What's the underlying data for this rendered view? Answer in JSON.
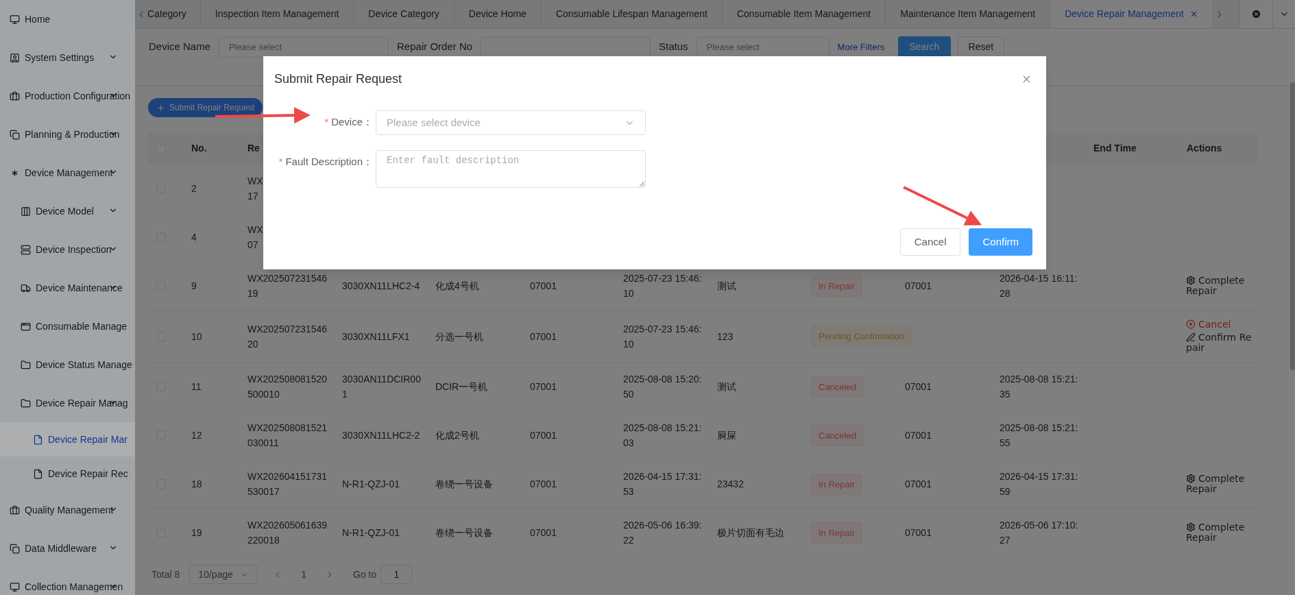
{
  "sidebar": {
    "items": [
      {
        "label": "Home",
        "has_submenu": false,
        "selected": false
      },
      {
        "label": "System Settings",
        "has_submenu": true,
        "selected": false
      },
      {
        "label": "Production Configuration",
        "has_submenu": true,
        "selected": false
      },
      {
        "label": "Planning & Production",
        "has_submenu": true,
        "selected": false
      },
      {
        "label": "Device Management",
        "has_submenu": true,
        "selected": false,
        "children": [
          {
            "label": "Device Model",
            "has_submenu": true,
            "selected": false
          },
          {
            "label": "Device Inspection",
            "has_submenu": true,
            "selected": false
          },
          {
            "label": "Device Maintenance",
            "has_submenu": true,
            "selected": false
          },
          {
            "label": "Consumable Manage",
            "has_submenu": false,
            "selected": false
          },
          {
            "label": "Device Status Manage",
            "has_submenu": false,
            "selected": false
          },
          {
            "label": "Device Repair Manag",
            "has_submenu": true,
            "selected": false,
            "children": [
              {
                "label": "Device Repair Mar",
                "has_submenu": false,
                "selected": true
              },
              {
                "label": "Device Repair Rec",
                "has_submenu": false,
                "selected": false
              }
            ]
          }
        ]
      },
      {
        "label": "Quality Management",
        "has_submenu": true,
        "selected": false
      },
      {
        "label": "Data Middleware",
        "has_submenu": true,
        "selected": false
      },
      {
        "label": "Collection Managemen",
        "has_submenu": true,
        "selected": false
      }
    ]
  },
  "tabs": [
    {
      "label": "Category",
      "selected": false,
      "closable": false
    },
    {
      "label": "Inspection Item Management",
      "selected": false,
      "closable": false
    },
    {
      "label": "Device Category",
      "selected": false,
      "closable": false
    },
    {
      "label": "Device Home",
      "selected": false,
      "closable": false
    },
    {
      "label": "Consumable Lifespan Management",
      "selected": false,
      "closable": false
    },
    {
      "label": "Consumable Item Management",
      "selected": false,
      "closable": false
    },
    {
      "label": "Maintenance Item Management",
      "selected": false,
      "closable": false
    },
    {
      "label": "Device Repair Management",
      "selected": true,
      "closable": true
    }
  ],
  "filters": {
    "device_name": {
      "label": "Device Name",
      "placeholder": "Please select"
    },
    "repair_order_no": {
      "label": "Repair Order No"
    },
    "status": {
      "label": "Status",
      "placeholder": "Please select"
    },
    "more_filters": "More Filters",
    "search": "Search",
    "reset": "Reset"
  },
  "add_button": "Submit Repair Request",
  "table": {
    "select_all_checked": false,
    "columns_left": [
      "No.",
      "Re"
    ],
    "columns_right": [
      "End Time",
      "Actions"
    ],
    "rows": [
      {
        "checked": false,
        "no": "2",
        "repair_no": "WX\n17"
      },
      {
        "checked": false,
        "no": "4",
        "repair_no": "WX\n07"
      },
      {
        "checked": false,
        "no": "9",
        "repair_no": "WX20250723154619",
        "device_code": "3030XN11LHC2-4",
        "device_name": "化成4号机",
        "dept": "07001",
        "start": "2025-07-23 15:46:10",
        "description": "测试",
        "status": {
          "label": "In Repair",
          "kind": "danger"
        },
        "operator": "07001",
        "time": "2026-04-15 16:11:28",
        "actions": [
          {
            "label": "Complete Repair",
            "kind": "complete"
          }
        ]
      },
      {
        "checked": false,
        "no": "10",
        "repair_no": "WX20250723154620",
        "device_code": "3030XN11LFX1",
        "device_name": "分选一号机",
        "dept": "07001",
        "start": "2025-07-23 15:46:10",
        "description": "123",
        "status": {
          "label": "Pending Confirmation",
          "kind": "warning"
        },
        "actions": [
          {
            "label": "Cancel",
            "kind": "cancel"
          },
          {
            "label": "Confirm Repair",
            "kind": "confirm"
          }
        ]
      },
      {
        "checked": false,
        "no": "11",
        "repair_no": "WX202508081520500010",
        "device_code": "3030AN11DCIR001",
        "device_name": "DCIR一号机",
        "dept": "07001",
        "start": "2025-08-08 15:20:50",
        "description": "测试",
        "status": {
          "label": "Canceled",
          "kind": "danger"
        },
        "operator": "07001",
        "time": "2025-08-08 15:21:35"
      },
      {
        "checked": false,
        "no": "12",
        "repair_no": "WX202508081521030011",
        "device_code": "3030XN11LHC2-2",
        "device_name": "化成2号机",
        "dept": "07001",
        "start": "2025-08-08 15:21:03",
        "description": "屙屎",
        "status": {
          "label": "Canceled",
          "kind": "danger"
        },
        "operator": "07001",
        "time": "2025-08-08 15:21:55"
      },
      {
        "checked": false,
        "no": "18",
        "repair_no": "WX202604151731530017",
        "device_code": "N-R1-QZJ-01",
        "device_name": "卷绕一号设备",
        "dept": "07001",
        "start": "2026-04-15 17:31:53",
        "description": "23432",
        "status": {
          "label": "In Repair",
          "kind": "danger"
        },
        "operator": "07001",
        "time": "2026-04-15 17:31:59",
        "actions": [
          {
            "label": "Complete Repair",
            "kind": "complete"
          }
        ]
      },
      {
        "checked": false,
        "no": "19",
        "repair_no": "WX202605061639220018",
        "device_code": "N-R1-QZJ-01",
        "device_name": "卷绕一号设备",
        "dept": "07001",
        "start": "2026-05-06 16:39:22",
        "description": "极片切面有毛边",
        "status": {
          "label": "In Repair",
          "kind": "danger"
        },
        "operator": "07001",
        "time": "2026-05-06 17:10:27",
        "actions": [
          {
            "label": "Complete Repair",
            "kind": "complete"
          }
        ]
      }
    ]
  },
  "pagination": {
    "total": "Total 8",
    "page_size": "10/page",
    "pages": [
      {
        "label": "1",
        "selected": true
      }
    ],
    "goto_label": "Go to",
    "goto_value": "1"
  },
  "dialog": {
    "title": "Submit Repair Request",
    "fields": [
      {
        "label": "Device：",
        "required_mark": "*",
        "kind": "select",
        "placeholder": "Please select device"
      },
      {
        "label": "Fault Description：",
        "required_mark": "*",
        "kind": "textarea",
        "placeholder": "Enter fault description"
      }
    ],
    "buttons": [
      {
        "label": "Cancel",
        "kind": "default"
      },
      {
        "label": "Confirm",
        "kind": "primary"
      }
    ]
  }
}
